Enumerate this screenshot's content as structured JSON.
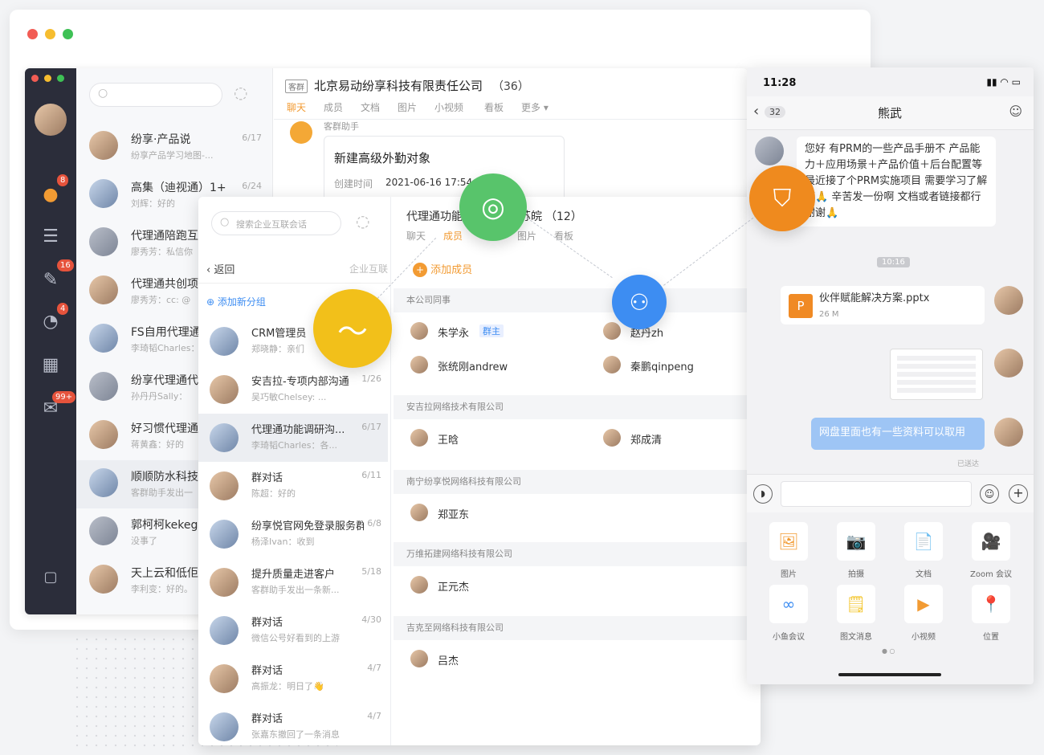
{
  "desktop": {
    "rail_badges": [
      "8",
      "16",
      "4",
      "99+"
    ],
    "conversations": [
      {
        "title": "纷享·产品说",
        "sub": "纷享产品学习地图-...",
        "date": "6/17"
      },
      {
        "title": "高集（迪视通）1+",
        "sub": "刘辉：好的",
        "date": "6/24"
      },
      {
        "title": "代理通陪跑互",
        "sub": "廖秀芳：私信你",
        "date": ""
      },
      {
        "title": "代理通共创项",
        "sub": "廖秀芳：cc: @",
        "date": ""
      },
      {
        "title": "FS自用代理通",
        "sub": "李琦韬Charles：",
        "date": ""
      },
      {
        "title": "纷享代理通代",
        "sub": "孙丹丹Sally：",
        "date": ""
      },
      {
        "title": "好习惯代理通",
        "sub": "蒋黄鑫：好的",
        "date": ""
      },
      {
        "title": "顺顺防水科技",
        "sub": "客群助手发出一",
        "date": ""
      },
      {
        "title": "郭柯柯kekeg",
        "sub": "没事了",
        "date": ""
      },
      {
        "title": "天上云和低佢",
        "sub": "李利变：好的。",
        "date": ""
      }
    ],
    "chat": {
      "tag": "客群",
      "title": "北京易动纷享科技有限责任公司",
      "count": "（36）",
      "tabs": [
        "聊天",
        "成员",
        "文档",
        "图片",
        "小视频",
        "看板",
        "更多 ▾"
      ],
      "sender": "客群助手",
      "card_title": "新建高级外勤对象",
      "card_label": "创建时间",
      "card_time": "2021-06-16 17:54"
    }
  },
  "middle": {
    "search_placeholder": "搜索企业互联会话",
    "back_label": "返回",
    "section_label": "企业互联",
    "add_group": "添加新分组",
    "conversations": [
      {
        "title": "CRM管理员",
        "sub": "郑晓静：亲们",
        "date": ""
      },
      {
        "title": "安吉拉-专项内部沟通",
        "sub": "吴巧敏Chelsey: ...",
        "date": "1/26"
      },
      {
        "title": "代理通功能调研沟...",
        "sub": "李琦韬Charles：各...",
        "date": "6/17"
      },
      {
        "title": "群对话",
        "sub": "陈超：好的",
        "date": "6/11"
      },
      {
        "title": "纷享悦官网免登录服务群",
        "sub": "杨泽Ivan：收到",
        "date": "6/8"
      },
      {
        "title": "提升质量走进客户",
        "sub": "客群助手发出一条新...",
        "date": "5/18"
      },
      {
        "title": "群对话",
        "sub": "微信公号好看到的上游",
        "date": "4/30"
      },
      {
        "title": "群对话",
        "sub": "高振龙：明日了👋",
        "date": "4/7"
      },
      {
        "title": "群对话",
        "sub": "张嘉东撤回了一条消息",
        "date": "4/7"
      }
    ],
    "group_title_a": "代理通功能",
    "group_title_b": "苏皖",
    "group_count": "（12）",
    "tabs": [
      "聊天",
      "成员",
      "",
      "图片",
      "看板"
    ],
    "add_member": "添加成员",
    "sections": [
      {
        "name": "本公司同事",
        "members": [
          {
            "name": "朱学永",
            "tag": "群主"
          },
          {
            "name": "赵丹zh",
            "tag": ""
          },
          {
            "name": "张统刚andrew",
            "tag": ""
          },
          {
            "name": "秦鹏qinpeng",
            "tag": ""
          }
        ]
      },
      {
        "name": "安吉拉网络技术有限公司",
        "members": [
          {
            "name": "王晗",
            "tag": ""
          },
          {
            "name": "郑成清",
            "tag": ""
          }
        ]
      },
      {
        "name": "南宁纷享悦网络科技有限公司",
        "members": [
          {
            "name": "郑亚东",
            "tag": ""
          }
        ]
      },
      {
        "name": "万维拓建网络科技有限公司",
        "members": [
          {
            "name": "正元杰",
            "tag": ""
          }
        ]
      },
      {
        "name": "吉克至网络科技有限公司",
        "members": [
          {
            "name": "吕杰",
            "tag": ""
          }
        ]
      }
    ]
  },
  "phone": {
    "time": "11:28",
    "back_count": "32",
    "title": "熊武",
    "message": "您好 有PRM的一些产品手册不 产品能力＋应用场景＋产品价值＋后台配置等 最近接了个PRM实施项目 需要学习了解下🙏 辛苦发一份啊 文档或者链接都行 谢谢🙏",
    "timestamp": "10:16",
    "file_name": "伙伴赋能解决方案.pptx",
    "file_size": "26 M",
    "file_letter": "P",
    "reply": "网盘里面也有一些资料可以取用",
    "delivered": "已送达",
    "grid": [
      {
        "label": "图片",
        "icon": "🖼"
      },
      {
        "label": "拍摄",
        "icon": "📷"
      },
      {
        "label": "文档",
        "icon": "📄"
      },
      {
        "label": "Zoom 会议",
        "icon": "🎥"
      },
      {
        "label": "小鱼会议",
        "icon": "∞"
      },
      {
        "label": "图文消息",
        "icon": "🗒"
      },
      {
        "label": "小视频",
        "icon": "▶"
      },
      {
        "label": "位置",
        "icon": "📍"
      }
    ]
  },
  "colors": {
    "accent": "#f29b33",
    "green": "#58c46b",
    "blue": "#3d8df2",
    "yellow": "#f2c01a",
    "orange": "#ef8a1e",
    "bubble_blue": "#9ec5f5"
  }
}
